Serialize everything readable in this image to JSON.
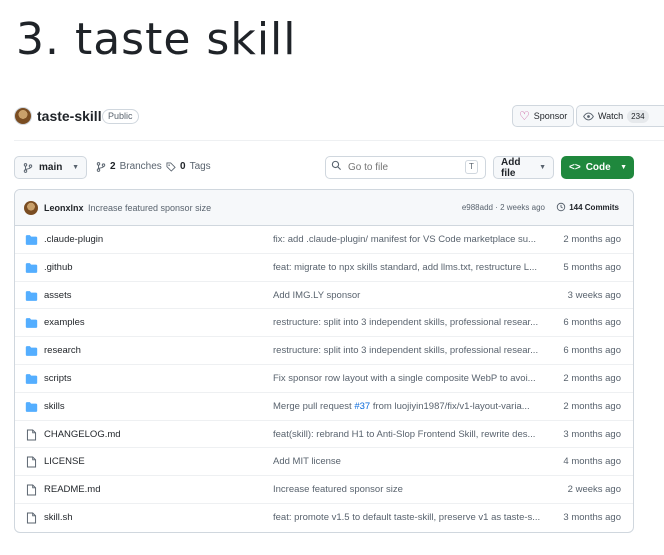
{
  "page_heading": "3. taste skill",
  "repo": {
    "name": "taste-skill",
    "visibility": "Public",
    "sponsor_label": "Sponsor",
    "watch_label": "Watch",
    "watch_count": "234"
  },
  "toolbar": {
    "branch": "main",
    "branches_count": "2",
    "branches_label": "Branches",
    "tags_count": "0",
    "tags_label": "Tags",
    "goto_placeholder": "Go to file",
    "goto_shortcut": "T",
    "add_file_label": "Add file",
    "code_label": "Code"
  },
  "latest_commit": {
    "author": "Leonxlnx",
    "message": "Increase featured sponsor size",
    "hash_time": "e988add · 2 weeks ago",
    "commits_label": "144 Commits"
  },
  "files": [
    {
      "type": "folder",
      "name": ".claude-plugin",
      "commit": "fix: add .claude-plugin/ manifest for VS Code marketplace su...",
      "time": "2 months ago"
    },
    {
      "type": "folder",
      "name": ".github",
      "commit": "feat: migrate to npx skills standard, add llms.txt, restructure L...",
      "time": "5 months ago"
    },
    {
      "type": "folder",
      "name": "assets",
      "commit": "Add IMG.LY sponsor",
      "time": "3 weeks ago"
    },
    {
      "type": "folder",
      "name": "examples",
      "commit": "restructure: split into 3 independent skills, professional resear...",
      "time": "6 months ago"
    },
    {
      "type": "folder",
      "name": "research",
      "commit": "restructure: split into 3 independent skills, professional resear...",
      "time": "6 months ago"
    },
    {
      "type": "folder",
      "name": "scripts",
      "commit": "Fix sponsor row layout with a single composite WebP to avoi...",
      "time": "2 months ago"
    },
    {
      "type": "folder",
      "name": "skills",
      "commit_prefix": "Merge pull request ",
      "commit_link": "#37",
      "commit_suffix": " from luojiyin1987/fix/v1-layout-varia...",
      "time": "2 months ago"
    },
    {
      "type": "file",
      "name": "CHANGELOG.md",
      "commit": "feat(skill): rebrand H1 to Anti-Slop Frontend Skill, rewrite des...",
      "time": "3 months ago"
    },
    {
      "type": "file",
      "name": "LICENSE",
      "commit": "Add MIT license",
      "time": "4 months ago"
    },
    {
      "type": "file",
      "name": "README.md",
      "commit": "Increase featured sponsor size",
      "time": "2 weeks ago"
    },
    {
      "type": "file",
      "name": "skill.sh",
      "commit": "feat: promote v1.5 to default taste-skill, preserve v1 as taste-s...",
      "time": "3 months ago"
    }
  ],
  "colors": {
    "folder": "#54aeff",
    "accent_green": "#1f883d",
    "link_blue": "#0969da",
    "sponsor_pink": "#bf3989"
  }
}
